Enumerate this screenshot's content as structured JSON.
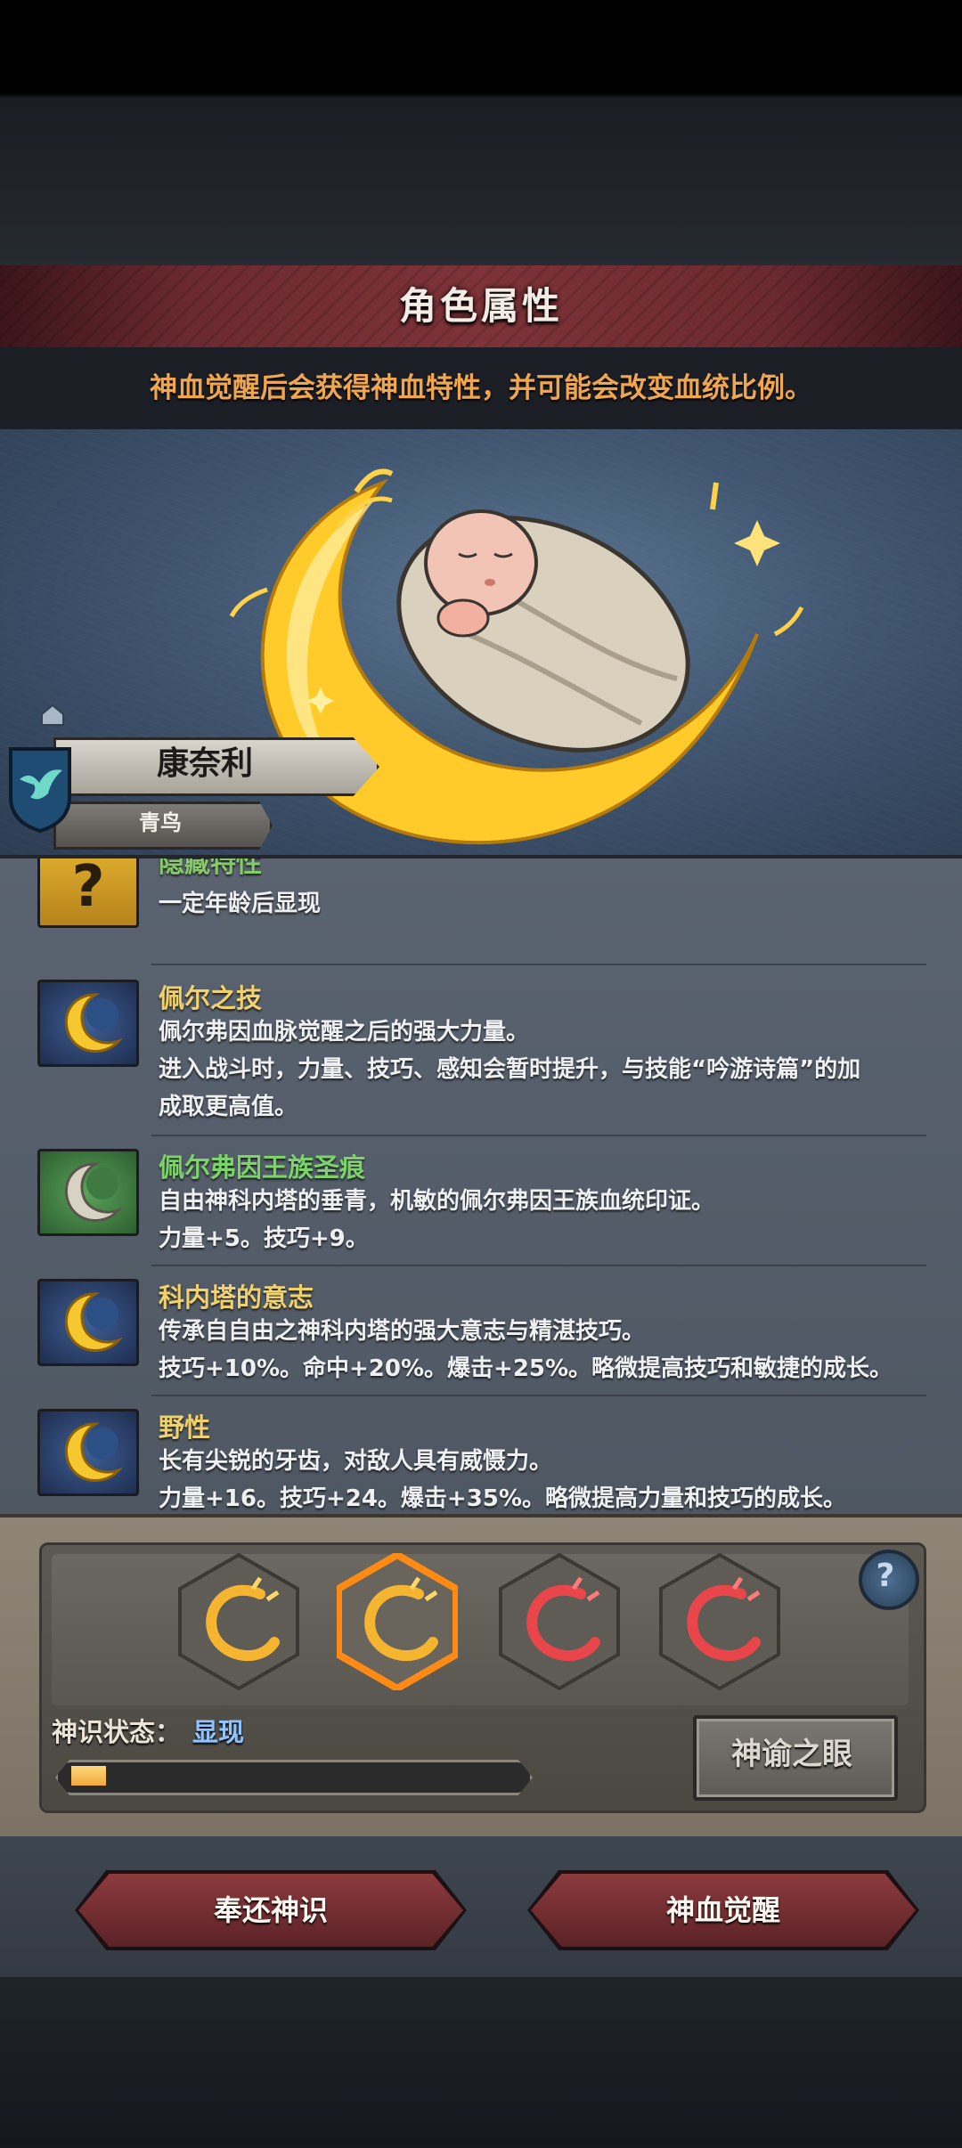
{
  "header": {
    "title": "角色属性",
    "notice": "神血觉醒后会获得神血特性，并可能会改变血统比例。"
  },
  "character": {
    "name": "康奈利",
    "title": "青鸟"
  },
  "traits": [
    {
      "name": "隐藏特性",
      "lines": [
        "一定年龄后显现"
      ],
      "icon": "question-icon",
      "name_color": "#86c86a"
    },
    {
      "name": "佩尔之技",
      "lines": [
        "佩尔弗因血脉觉醒之后的强大力量。",
        "进入战斗时，力量、技巧、感知会暂时提升，与技能“吟游诗篇”的加",
        "成取更高值。"
      ],
      "icon": "golden-crescent-icon",
      "name_color": "#f1d16a"
    },
    {
      "name": "佩尔弗因王族圣痕",
      "lines": [
        "自由神科内塔的垂青，机敏的佩尔弗因王族血统印证。",
        "力量+5。技巧+9。"
      ],
      "icon": "silver-crescent-icon",
      "name_color": "#7bd36a"
    },
    {
      "name": "科内塔的意志",
      "lines": [
        "传承自自由之神科内塔的强大意志与精湛技巧。",
        "技巧+10%。命中+20%。爆击+25%。略微提高技巧和敏捷的成长。"
      ],
      "icon": "golden-crescent-icon",
      "name_color": "#f1d16a"
    },
    {
      "name": "野性",
      "lines": [
        "长有尖锐的牙齿，对敌人具有威慑力。",
        "力量+16。技巧+24。爆击+35%。略微提高力量和技巧的成长。"
      ],
      "icon": "golden-crescent-icon",
      "name_color": "#f1d16a"
    }
  ],
  "awakening": {
    "slots": [
      {
        "icon": "gold-rune-icon",
        "color": "#f5b531",
        "selected": false
      },
      {
        "icon": "gold-rune-icon",
        "color": "#f5b531",
        "selected": true
      },
      {
        "icon": "red-rune-icon",
        "color": "#e8464a",
        "selected": false
      },
      {
        "icon": "red-rune-icon",
        "color": "#e8464a",
        "selected": false
      }
    ],
    "status_label": "神识状态：",
    "status_value": "显现",
    "progress": 0.05,
    "oracle_button": "神谕之眼",
    "help_glyph": "?"
  },
  "actions": {
    "return_label": "奉还神识",
    "awaken_label": "神血觉醒"
  },
  "colors": {
    "accent_orange": "#f0a64f",
    "title_red": "#7d3338",
    "status_blue": "#8fc4ff"
  }
}
